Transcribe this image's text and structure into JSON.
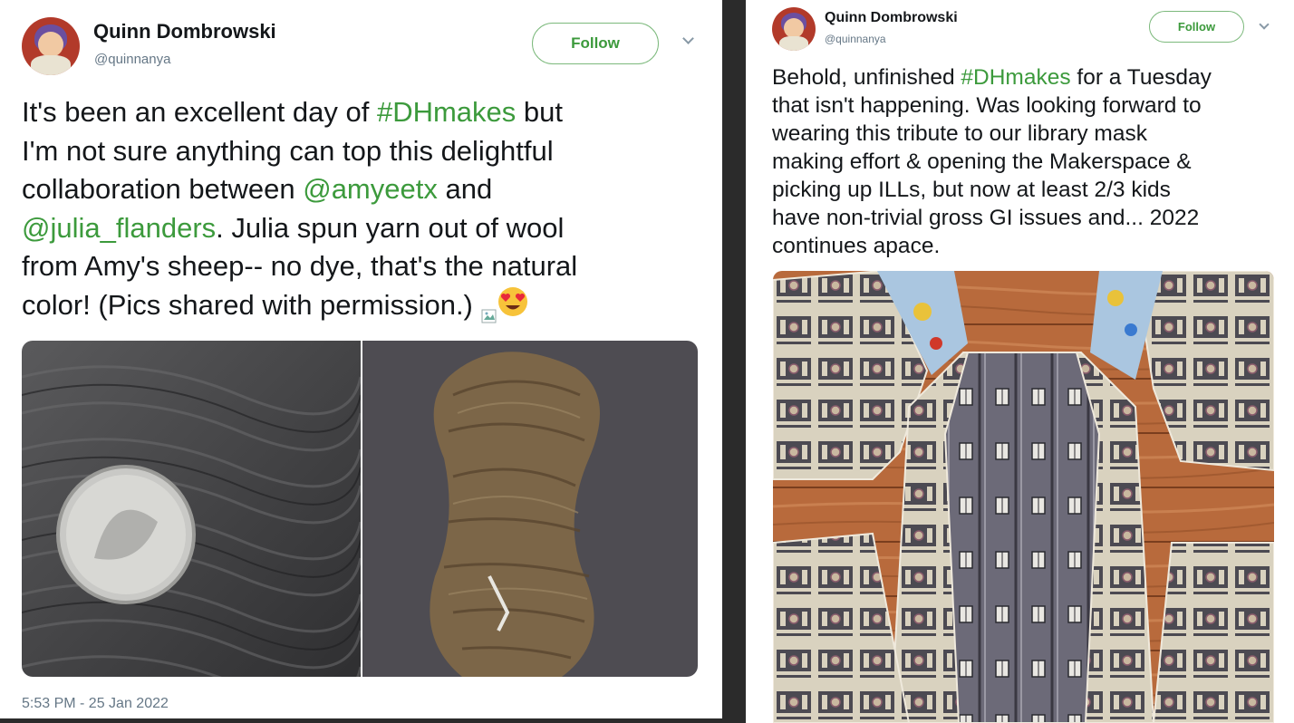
{
  "left_tweet": {
    "author_name": "Quinn Dombrowski",
    "author_handle": "@quinnanya",
    "follow_label": "Follow",
    "text_lines": [
      [
        {
          "t": "It's been an excellent day of "
        },
        {
          "t": "#DHmakes",
          "link": true
        },
        {
          "t": " but"
        }
      ],
      [
        {
          "t": "I'm not sure anything can top this delightful"
        }
      ],
      [
        {
          "t": "collaboration between "
        },
        {
          "t": "@amyeetx",
          "link": true
        },
        {
          "t": " and"
        }
      ],
      [
        {
          "t": "@julia_flanders",
          "link": true
        },
        {
          "t": ". Julia spun yarn out of wool"
        }
      ],
      [
        {
          "t": "from Amy's sheep-- no dye, that's the natural"
        }
      ],
      [
        {
          "t": "color! (Pics shared with permission.) "
        }
      ]
    ],
    "trailing_emoji": "heart-eyes-emoji",
    "timestamp": "5:53 PM - 25 Jan 2022",
    "photos": [
      "yarn-closeup-with-quarter",
      "yarn-skein"
    ]
  },
  "right_tweet": {
    "author_name": "Quinn Dombrowski",
    "author_handle": "@quinnanya",
    "follow_label": "Follow",
    "text_lines": [
      [
        {
          "t": "Behold, unfinished "
        },
        {
          "t": "#DHmakes",
          "link": true
        },
        {
          "t": " for a Tuesday"
        }
      ],
      [
        {
          "t": "that isn't happening. Was looking forward to"
        }
      ],
      [
        {
          "t": "wearing this tribute to our library mask"
        }
      ],
      [
        {
          "t": "making effort & opening the Makerspace &"
        }
      ],
      [
        {
          "t": "picking up ILLs, but now at least 2/3 kids"
        }
      ],
      [
        {
          "t": "have non-trivial gross GI issues and... 2022"
        }
      ],
      [
        {
          "t": "continues apace."
        }
      ]
    ],
    "photos": [
      "dress-fabric-pieces-on-floor"
    ]
  },
  "colors": {
    "link_green": "#3c9a3c",
    "text_dark": "#14171a",
    "text_gray": "#657786",
    "divider_dark": "#2b2b2b"
  }
}
